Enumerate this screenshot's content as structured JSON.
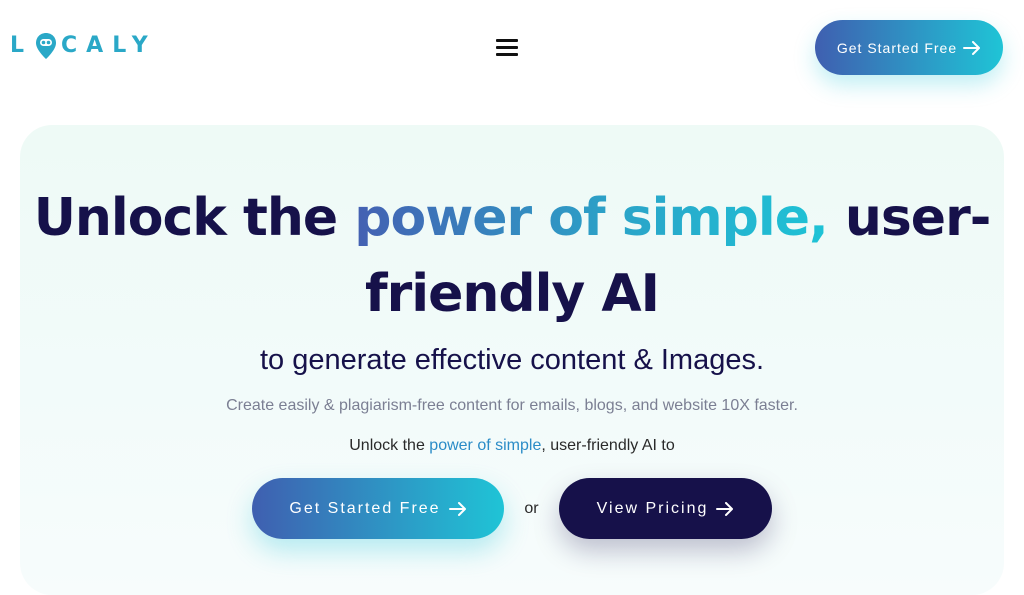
{
  "header": {
    "logo": {
      "left_text": "L",
      "right_text": "CALY",
      "pin_icon": "map-pin-icon"
    },
    "menu_icon": "hamburger-menu-icon",
    "cta_label": "Get Started Free",
    "arrow_icon": "arrow-right-icon"
  },
  "hero": {
    "headline_start": "Unlock the ",
    "headline_highlight": "power of simple,",
    "headline_end": " user-friendly AI",
    "subheadline": "to generate effective content & Images.",
    "description": "Create easily & plagiarism-free content for emails, blogs, and website 10X faster.",
    "typed_line": {
      "start": "Unlock the ",
      "highlight": "power of simple",
      "end": ", user-friendly AI to"
    },
    "primary_button": "Get Started Free",
    "or_text": "or",
    "secondary_button": "View Pricing"
  },
  "colors": {
    "brand_teal": "#2aa8c7",
    "navy": "#16114a",
    "gradient_start": "#3f5fb0",
    "gradient_end": "#1fc4d6",
    "hero_bg": "#eefaf6"
  }
}
